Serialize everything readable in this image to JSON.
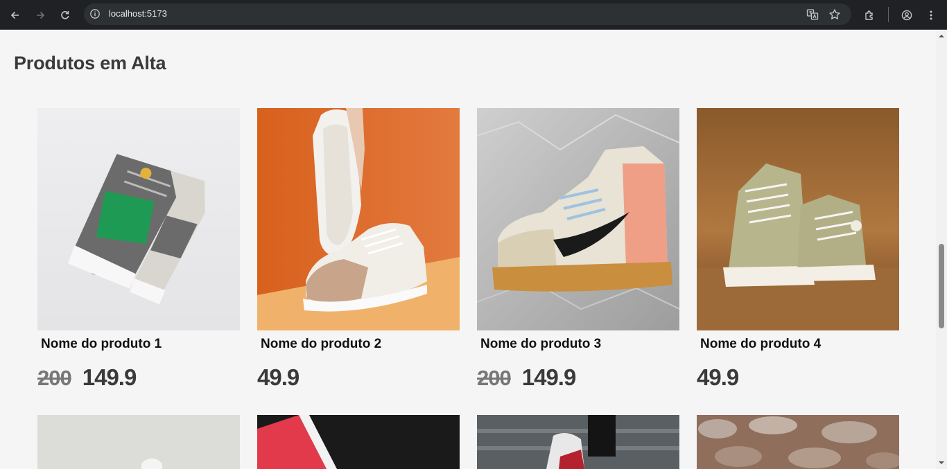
{
  "browser": {
    "url": "localhost:5173"
  },
  "section": {
    "title": "Produtos em Alta"
  },
  "products": [
    {
      "name": "Nome do produto 1",
      "old_price": "200",
      "price": "149.9"
    },
    {
      "name": "Nome do produto 2",
      "old_price": "",
      "price": "49.9"
    },
    {
      "name": "Nome do produto 3",
      "old_price": "200",
      "price": "149.9"
    },
    {
      "name": "Nome do produto 4",
      "old_price": "",
      "price": "49.9"
    }
  ],
  "colors": {
    "chrome_bg": "#202124",
    "omnibox_bg": "#2d3134",
    "page_bg": "#f5f5f5",
    "title_text": "#3a3a3a",
    "old_price_text": "#777777"
  }
}
